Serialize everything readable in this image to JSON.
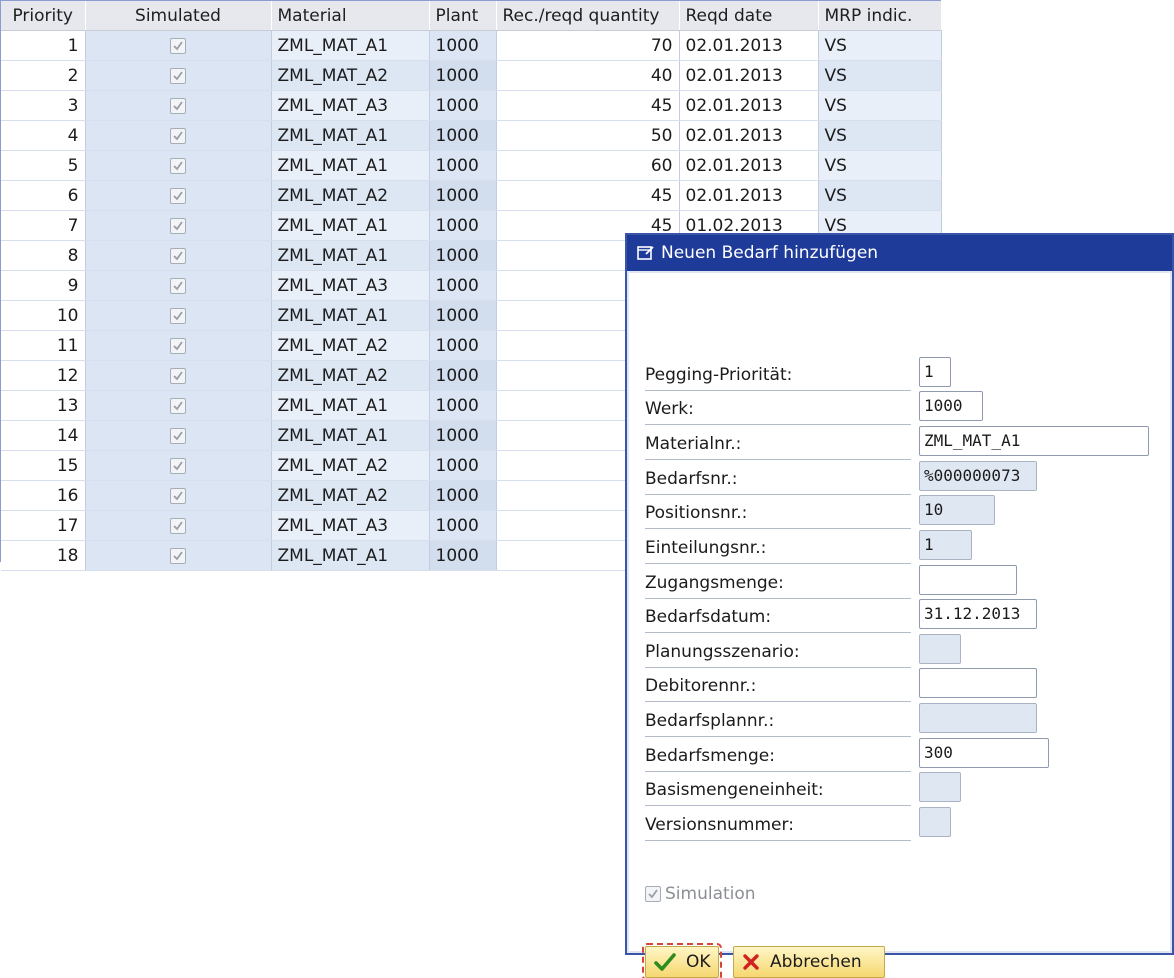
{
  "table": {
    "columns": [
      "Priority",
      "Simulated",
      "Material",
      "Plant",
      "Rec./reqd quantity",
      "Reqd  date",
      "MRP indic."
    ],
    "rows": [
      {
        "priority": "1",
        "simulated": true,
        "material": "ZML_MAT_A1",
        "plant": "1000",
        "quantity": "70",
        "date": "02.01.2013",
        "mrp": "VS"
      },
      {
        "priority": "2",
        "simulated": true,
        "material": "ZML_MAT_A2",
        "plant": "1000",
        "quantity": "40",
        "date": "02.01.2013",
        "mrp": "VS"
      },
      {
        "priority": "3",
        "simulated": true,
        "material": "ZML_MAT_A3",
        "plant": "1000",
        "quantity": "45",
        "date": "02.01.2013",
        "mrp": "VS"
      },
      {
        "priority": "4",
        "simulated": true,
        "material": "ZML_MAT_A1",
        "plant": "1000",
        "quantity": "50",
        "date": "02.01.2013",
        "mrp": "VS"
      },
      {
        "priority": "5",
        "simulated": true,
        "material": "ZML_MAT_A1",
        "plant": "1000",
        "quantity": "60",
        "date": "02.01.2013",
        "mrp": "VS"
      },
      {
        "priority": "6",
        "simulated": true,
        "material": "ZML_MAT_A2",
        "plant": "1000",
        "quantity": "45",
        "date": "02.01.2013",
        "mrp": "VS"
      },
      {
        "priority": "7",
        "simulated": true,
        "material": "ZML_MAT_A1",
        "plant": "1000",
        "quantity": "45",
        "date": "01.02.2013",
        "mrp": "VS"
      },
      {
        "priority": "8",
        "simulated": true,
        "material": "ZML_MAT_A1",
        "plant": "1000",
        "quantity": "",
        "date": "",
        "mrp": ""
      },
      {
        "priority": "9",
        "simulated": true,
        "material": "ZML_MAT_A3",
        "plant": "1000",
        "quantity": "",
        "date": "",
        "mrp": ""
      },
      {
        "priority": "10",
        "simulated": true,
        "material": "ZML_MAT_A1",
        "plant": "1000",
        "quantity": "",
        "date": "",
        "mrp": ""
      },
      {
        "priority": "11",
        "simulated": true,
        "material": "ZML_MAT_A2",
        "plant": "1000",
        "quantity": "",
        "date": "",
        "mrp": ""
      },
      {
        "priority": "12",
        "simulated": true,
        "material": "ZML_MAT_A2",
        "plant": "1000",
        "quantity": "",
        "date": "",
        "mrp": ""
      },
      {
        "priority": "13",
        "simulated": true,
        "material": "ZML_MAT_A1",
        "plant": "1000",
        "quantity": "",
        "date": "",
        "mrp": ""
      },
      {
        "priority": "14",
        "simulated": true,
        "material": "ZML_MAT_A1",
        "plant": "1000",
        "quantity": "",
        "date": "",
        "mrp": ""
      },
      {
        "priority": "15",
        "simulated": true,
        "material": "ZML_MAT_A2",
        "plant": "1000",
        "quantity": "",
        "date": "",
        "mrp": ""
      },
      {
        "priority": "16",
        "simulated": true,
        "material": "ZML_MAT_A2",
        "plant": "1000",
        "quantity": "",
        "date": "",
        "mrp": ""
      },
      {
        "priority": "17",
        "simulated": true,
        "material": "ZML_MAT_A3",
        "plant": "1000",
        "quantity": "",
        "date": "",
        "mrp": ""
      },
      {
        "priority": "18",
        "simulated": true,
        "material": "ZML_MAT_A1",
        "plant": "1000",
        "quantity": "",
        "date": "",
        "mrp": ""
      }
    ]
  },
  "dialog": {
    "title": "Neuen Bedarf hinzufügen",
    "title_icon": "edit-window-icon",
    "fields": [
      {
        "key": "pegging-prioritaet",
        "label": "Pegging-Priorität:",
        "value": "1",
        "readonly": false
      },
      {
        "key": "werk",
        "label": "Werk:",
        "value": "1000",
        "readonly": false
      },
      {
        "key": "materialnr",
        "label": "Materialnr.:",
        "value": "ZML_MAT_A1",
        "readonly": false
      },
      {
        "key": "bedarfsnr",
        "label": "Bedarfsnr.:",
        "value": "%000000073",
        "readonly": true
      },
      {
        "key": "positionsnr",
        "label": "Positionsnr.:",
        "value": "10",
        "readonly": true
      },
      {
        "key": "einteilungsnr",
        "label": "Einteilungsnr.:",
        "value": "1",
        "readonly": true
      },
      {
        "key": "zugangsmenge",
        "label": "Zugangsmenge:",
        "value": "",
        "readonly": false
      },
      {
        "key": "bedarfsdatum",
        "label": "Bedarfsdatum:",
        "value": "31.12.2013",
        "readonly": false
      },
      {
        "key": "planungsszenario",
        "label": "Planungsszenario:",
        "value": "",
        "readonly": true
      },
      {
        "key": "debitorennr",
        "label": "Debitorennr.:",
        "value": "",
        "readonly": false
      },
      {
        "key": "bedarfsplannr",
        "label": "Bedarfsplannr.:",
        "value": "",
        "readonly": true
      },
      {
        "key": "bedarfsmenge",
        "label": "Bedarfsmenge:",
        "value": "300",
        "readonly": false
      },
      {
        "key": "basismengeneinheit",
        "label": "Basismengeneinheit:",
        "value": "",
        "readonly": true
      },
      {
        "key": "versionsnummer",
        "label": "Versionsnummer:",
        "value": "",
        "readonly": true
      }
    ],
    "simulation": {
      "label": "Simulation",
      "checked": true,
      "disabled": true
    },
    "buttons": {
      "ok": {
        "label": "OK",
        "icon": "check-icon",
        "icon_color": "#2e8b1e"
      },
      "cancel": {
        "label": "Abbrechen",
        "icon": "close-icon",
        "icon_color": "#d02020"
      }
    }
  }
}
